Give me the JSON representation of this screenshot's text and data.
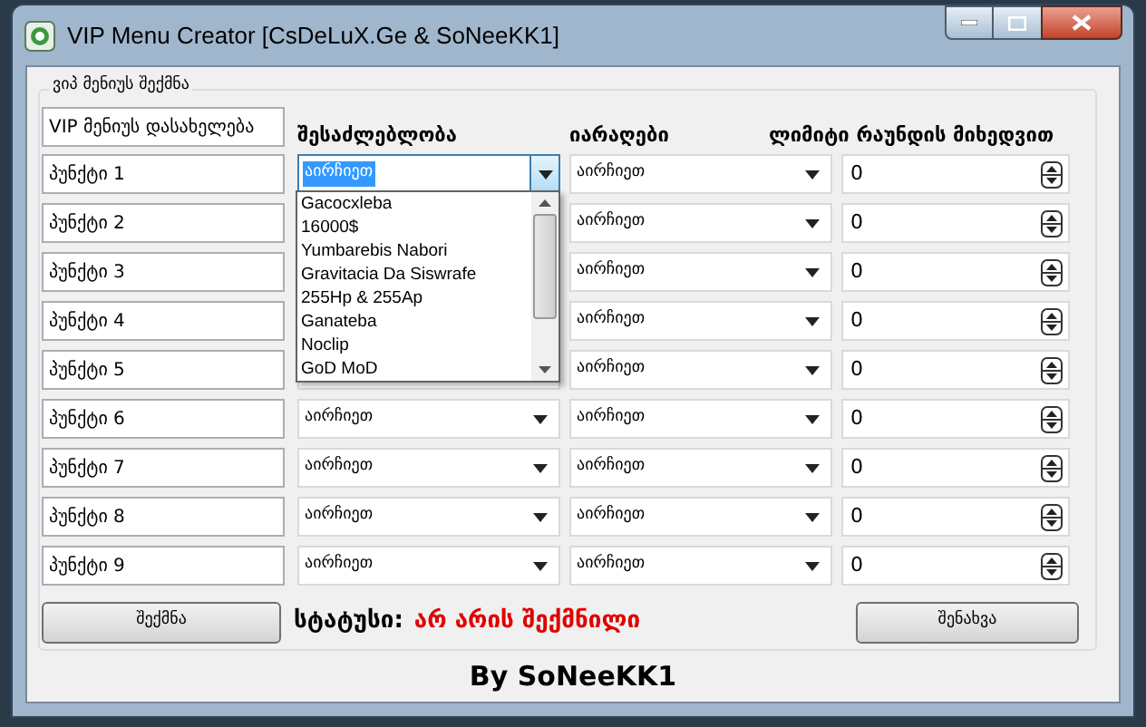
{
  "window": {
    "title": "VIP Menu Creator [CsDeLuX.Ge & SoNeeKK1]"
  },
  "group": {
    "title": "ვიპ მენიუს შექმნა",
    "name_field": {
      "value": "VIP მენიუს დასახელება"
    },
    "columns": [
      "შესაძლებლობა",
      "იარაღები",
      "ლიმიტი რაუნდის მიხედვით"
    ],
    "rows": [
      {
        "item": "პუნქტი 1",
        "ability": "აირჩიეთ",
        "ability_focused": true,
        "weapon": "აირჩიეთ",
        "limit": "0"
      },
      {
        "item": "პუნქტი 2",
        "weapon": "აირჩიეთ",
        "limit": "0"
      },
      {
        "item": "პუნქტი 3",
        "weapon": "აირჩიეთ",
        "limit": "0"
      },
      {
        "item": "პუნქტი 4",
        "weapon": "აირჩიეთ",
        "limit": "0"
      },
      {
        "item": "პუნქტი 5",
        "weapon": "აირჩიეთ",
        "limit": "0"
      },
      {
        "item": "პუნქტი 6",
        "ability": "აირჩიეთ",
        "ability_focused": false,
        "weapon": "აირჩიეთ",
        "limit": "0"
      },
      {
        "item": "პუნქტი 7",
        "ability": "აირჩიეთ",
        "ability_focused": false,
        "weapon": "აირჩიეთ",
        "limit": "0"
      },
      {
        "item": "პუნქტი 8",
        "ability": "აირჩიეთ",
        "ability_focused": false,
        "weapon": "აირჩიეთ",
        "limit": "0"
      },
      {
        "item": "პუნქტი 9",
        "ability": "აირჩიეთ",
        "ability_focused": false,
        "weapon": "აირჩიეთ",
        "limit": "0"
      }
    ],
    "dropdown_list": [
      "Gacocxleba",
      "16000$",
      "Yumbarebis Nabori",
      "Gravitacia Da Siswrafe",
      "255Hp & 255Ap",
      "Ganateba",
      "Noclip",
      "GoD MoD"
    ],
    "create_button": "შექმნა",
    "status_label": "სტატუსი:",
    "status_value": "არ არის შექმნილი",
    "save_button": "შენახვა"
  },
  "footer": "By SoNeeKK1"
}
